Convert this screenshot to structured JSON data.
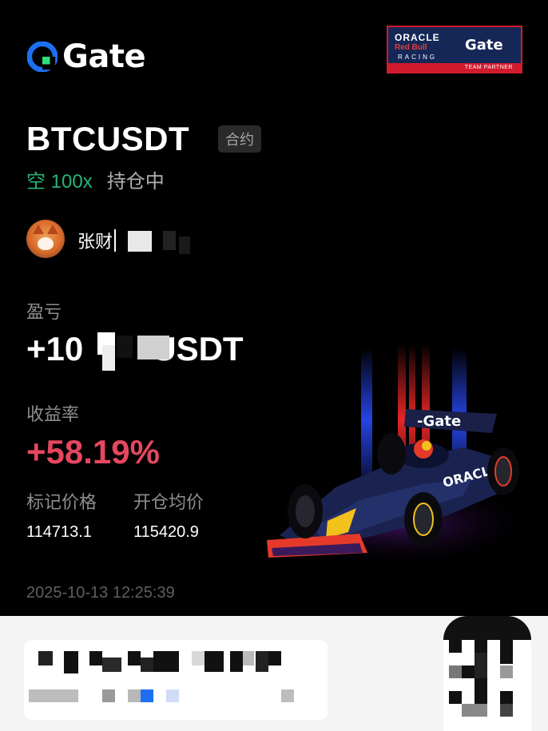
{
  "brand": {
    "logo_text": "Gate",
    "logo_color": "#1d6ff2",
    "accent_color": "#2fe081"
  },
  "partner_badge": {
    "oracle": "ORACLE",
    "redbull": "Red Bull",
    "racing": "RACING",
    "gate": "Gate",
    "tagline": "TEAM PARTNER"
  },
  "position": {
    "symbol": "BTCUSDT",
    "type_badge": "合约",
    "side": "空",
    "leverage": "100x",
    "status": "持仓中"
  },
  "user": {
    "name": "张财"
  },
  "pnl": {
    "label": "盈亏",
    "value": "+10",
    "value_tail": "USDT"
  },
  "roi": {
    "label": "收益率",
    "value": "+58.19%"
  },
  "prices": {
    "mark_label": "标记价格",
    "mark_value": "114713.1",
    "entry_label": "开仓均价",
    "entry_value": "115420.9"
  },
  "timestamp": "2025-10-13 12:25:39",
  "colors": {
    "short": "#27b478",
    "roi": "#e5475f",
    "partner_bg": "#152757",
    "partner_border": "#d11b2d"
  }
}
